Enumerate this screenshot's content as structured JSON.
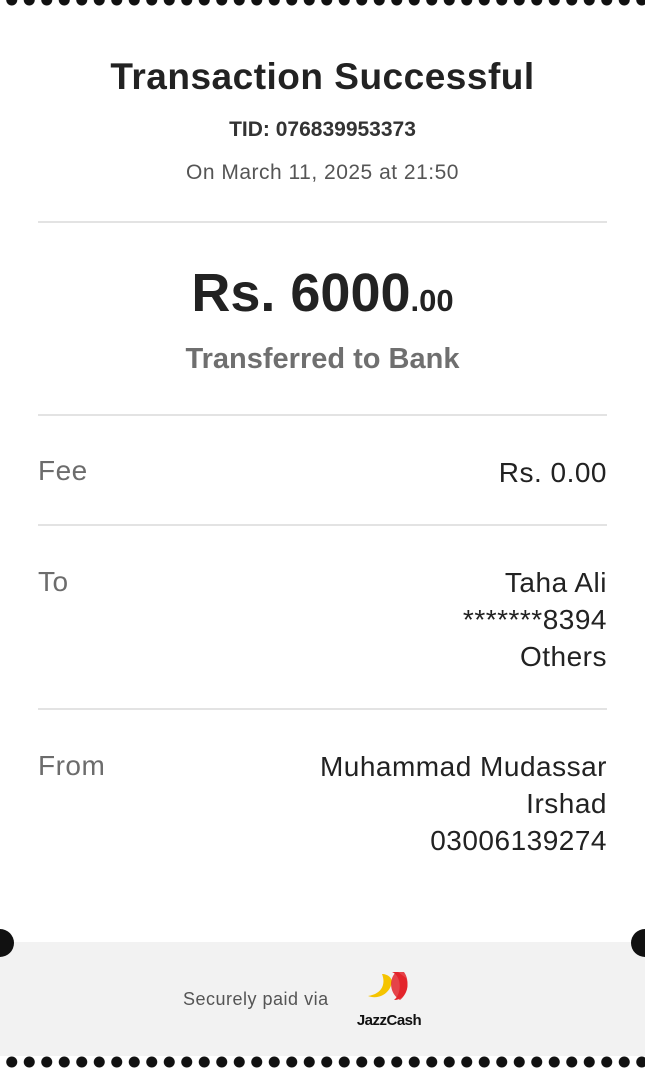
{
  "receipt": {
    "title": "Transaction Successful",
    "tid": "TID: 076839953373",
    "date": "On March 11, 2025 at 21:50",
    "amount_main": "Rs. 6000",
    "amount_decimal": ".00",
    "transfer_label": "Transferred to Bank"
  },
  "fee": {
    "label": "Fee",
    "value": "Rs. 0.00"
  },
  "to": {
    "label": "To",
    "name": "Taha Ali",
    "account": "*******8394",
    "bank": "Others"
  },
  "from": {
    "label": "From",
    "name_line1": "Muhammad Mudassar",
    "name_line2": "Irshad",
    "number": "03006139274"
  },
  "footer": {
    "secure_text": "Securely paid via",
    "brand": "JazzCash"
  },
  "colors": {
    "brand_yellow": "#f5c400",
    "brand_red": "#e3242b"
  },
  "icons": {
    "logo": "jazzcash-logo"
  }
}
